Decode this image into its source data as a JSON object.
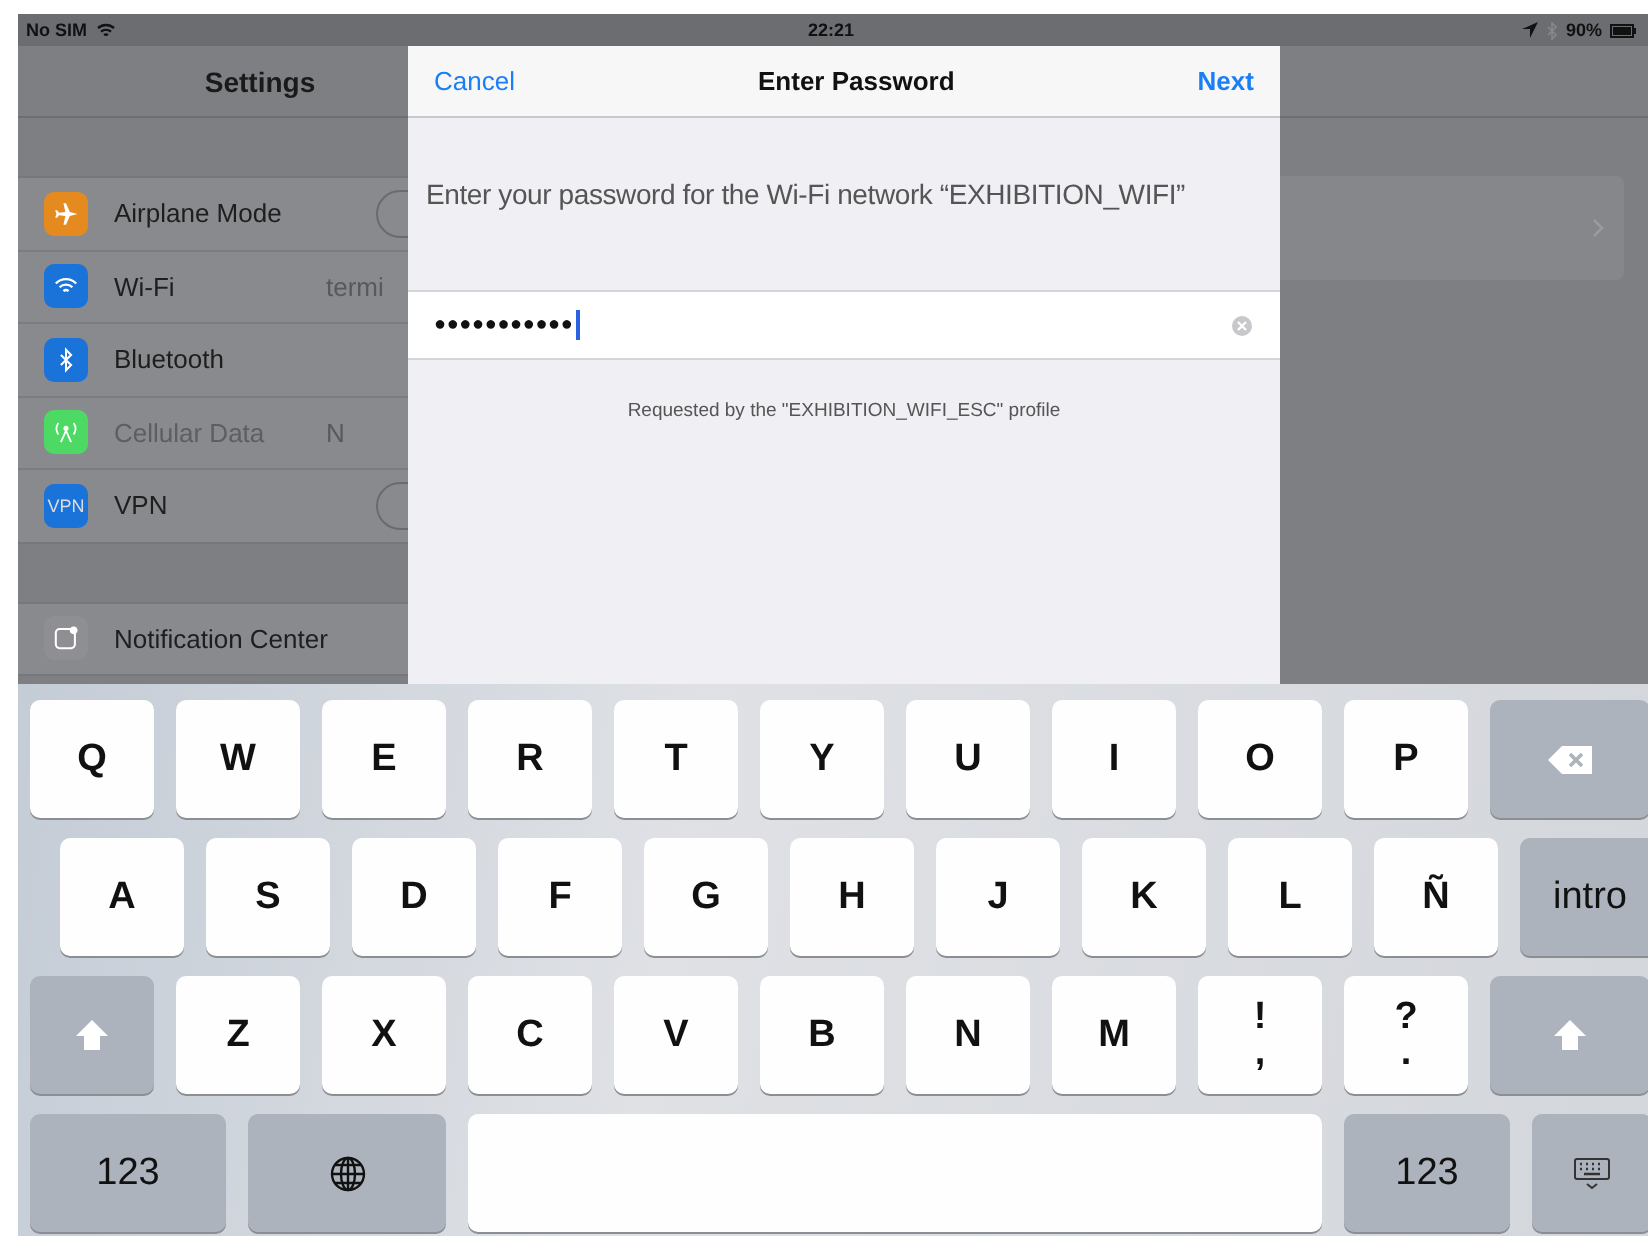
{
  "status_bar": {
    "carrier": "No SIM",
    "time": "22:21",
    "battery": "90%"
  },
  "settings": {
    "title": "Settings",
    "groups": [
      {
        "items": [
          {
            "label": "Airplane Mode",
            "color": "#e58a1f",
            "kind": "toggle",
            "on": false
          },
          {
            "label": "Wi-Fi",
            "color": "#1a73d9",
            "kind": "value",
            "value": "termi"
          },
          {
            "label": "Bluetooth",
            "color": "#1a73d9",
            "kind": "plain"
          },
          {
            "label": "Cellular Data",
            "color": "#4cd964",
            "kind": "value",
            "value": "N",
            "disabled": true
          },
          {
            "label": "VPN",
            "color": "#1a73d9",
            "kind": "toggle",
            "on": false,
            "badge": "VPN"
          }
        ]
      },
      {
        "items": [
          {
            "label": "Notification Center",
            "color": "#8e8e93",
            "kind": "plain"
          }
        ]
      }
    ]
  },
  "dialog": {
    "cancel": "Cancel",
    "title": "Enter Password",
    "next": "Next",
    "message": "Enter your password for the Wi-Fi network “EXHIBITION_WIFI”",
    "password": "●●●●●●●●●●●",
    "note": "Requested by the \"EXHIBITION_WIFI_ESC\" profile"
  },
  "keyboard": {
    "rows": [
      {
        "keys": [
          {
            "kind": "letter",
            "label": "Q"
          },
          {
            "kind": "letter",
            "label": "W"
          },
          {
            "kind": "letter",
            "label": "E"
          },
          {
            "kind": "letter",
            "label": "R"
          },
          {
            "kind": "letter",
            "label": "T"
          },
          {
            "kind": "letter",
            "label": "Y"
          },
          {
            "kind": "letter",
            "label": "U"
          },
          {
            "kind": "letter",
            "label": "I"
          },
          {
            "kind": "letter",
            "label": "O"
          },
          {
            "kind": "letter",
            "label": "P"
          },
          {
            "kind": "delete"
          }
        ]
      },
      {
        "keys": [
          {
            "kind": "letter",
            "label": "A"
          },
          {
            "kind": "letter",
            "label": "S"
          },
          {
            "kind": "letter",
            "label": "D"
          },
          {
            "kind": "letter",
            "label": "F"
          },
          {
            "kind": "letter",
            "label": "G"
          },
          {
            "kind": "letter",
            "label": "H"
          },
          {
            "kind": "letter",
            "label": "J"
          },
          {
            "kind": "letter",
            "label": "K"
          },
          {
            "kind": "letter",
            "label": "L"
          },
          {
            "kind": "letter",
            "label": "Ñ"
          },
          {
            "kind": "return",
            "label": "intro"
          }
        ]
      },
      {
        "keys": [
          {
            "kind": "shift"
          },
          {
            "kind": "letter",
            "label": "Z"
          },
          {
            "kind": "letter",
            "label": "X"
          },
          {
            "kind": "letter",
            "label": "C"
          },
          {
            "kind": "letter",
            "label": "V"
          },
          {
            "kind": "letter",
            "label": "B"
          },
          {
            "kind": "letter",
            "label": "N"
          },
          {
            "kind": "letter",
            "label": "M"
          },
          {
            "kind": "letter",
            "label": "!",
            "sub": ","
          },
          {
            "kind": "letter",
            "label": "?",
            "sub": "."
          },
          {
            "kind": "shift"
          }
        ]
      },
      {
        "keys": [
          {
            "kind": "numbers",
            "label": "123"
          },
          {
            "kind": "globe"
          },
          {
            "kind": "space"
          },
          {
            "kind": "numbers",
            "label": "123"
          },
          {
            "kind": "hide"
          }
        ]
      }
    ]
  }
}
